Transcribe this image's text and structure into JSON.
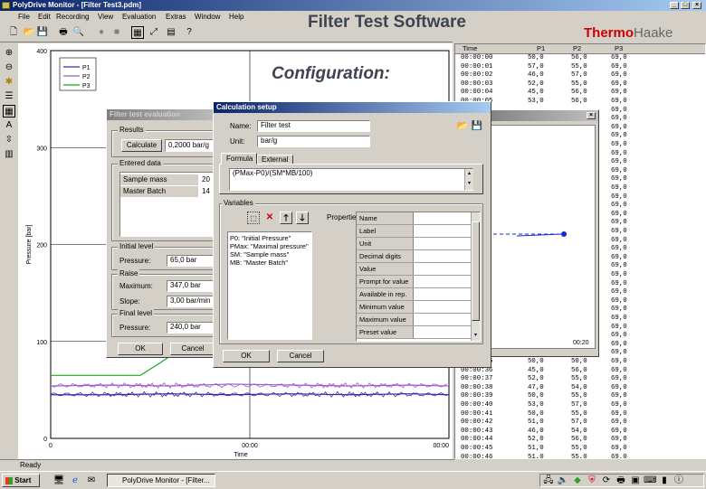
{
  "app": {
    "title": "PolyDrive Monitor - [Filter Test3.pdm]",
    "menu": [
      "File",
      "Edit",
      "Recording",
      "View",
      "Evaluation",
      "Extras",
      "Window",
      "Help"
    ],
    "status": "Ready"
  },
  "overlay": {
    "heading": "Filter Test Software",
    "logo_bold": "Thermo",
    "logo_light": "Haake",
    "subheading": "Configuration:"
  },
  "chart_data": {
    "type": "line",
    "ylabel": "Pressure [bar]",
    "xlabel": "Time",
    "y_ticks": [
      "400",
      "300",
      "200",
      "100",
      "0"
    ],
    "x_ticks": [
      "0",
      "00:00",
      "00:00"
    ],
    "ylim": [
      0,
      400
    ],
    "xlim": [
      0,
      2
    ],
    "legend": [
      "P1",
      "P2",
      "P3"
    ],
    "legend_placement": "top-left",
    "series": [
      {
        "name": "P1",
        "color": "#3b2aa8",
        "x": [
          0,
          0.3,
          0.6,
          0.9,
          1.2,
          1.5,
          1.8,
          2.0
        ],
        "y": [
          45,
          45,
          46,
          45,
          46,
          45,
          46,
          45
        ]
      },
      {
        "name": "P2",
        "color": "#9b59d0",
        "x": [
          0,
          0.3,
          0.6,
          0.9,
          1.2,
          1.5,
          1.8,
          2.0
        ],
        "y": [
          54,
          55,
          54,
          56,
          55,
          54,
          55,
          54
        ]
      },
      {
        "name": "P3",
        "color": "#1fa91f",
        "x": [
          0,
          0.35,
          0.45,
          0.55,
          0.6
        ],
        "y": [
          65,
          65,
          65,
          78,
          85
        ]
      }
    ]
  },
  "table": {
    "headers": [
      "Time",
      "P1",
      "P2",
      "P3"
    ],
    "rows": [
      [
        "00:00:00",
        "50,0",
        "56,0",
        "69,0"
      ],
      [
        "00:00:01",
        "57,0",
        "55,0",
        "69,0"
      ],
      [
        "00:00:02",
        "46,0",
        "57,0",
        "69,0"
      ],
      [
        "00:00:03",
        "52,0",
        "55,0",
        "69,0"
      ],
      [
        "00:00:04",
        "45,0",
        "56,0",
        "69,0"
      ],
      [
        "00:00:05",
        "53,0",
        "56,0",
        "69,0"
      ],
      [
        "",
        "",
        "",
        "69,0"
      ],
      [
        "",
        "",
        "",
        "69,0"
      ],
      [
        "",
        "",
        "",
        "69,0"
      ],
      [
        "",
        "",
        "",
        "69,0"
      ],
      [
        "",
        "",
        "",
        "69,0"
      ],
      [
        "",
        "",
        "",
        "69,0"
      ],
      [
        "",
        "",
        "",
        "69,0"
      ],
      [
        "",
        "",
        "",
        "69,0"
      ],
      [
        "",
        "",
        "",
        "69,0"
      ],
      [
        "",
        "",
        "",
        "69,0"
      ],
      [
        "",
        "",
        "",
        "69,0"
      ],
      [
        "",
        "",
        "",
        "69,0"
      ],
      [
        "",
        "",
        "",
        "69,0"
      ],
      [
        "",
        "",
        "",
        "69,0"
      ],
      [
        "",
        "",
        "",
        "69,0"
      ],
      [
        "",
        "",
        "",
        "69,0"
      ],
      [
        "",
        "",
        "",
        "69,0"
      ],
      [
        "",
        "",
        "",
        "69,0"
      ],
      [
        "",
        "",
        "",
        "69,0"
      ],
      [
        "",
        "",
        "",
        "69,0"
      ],
      [
        "",
        "",
        "",
        "69,0"
      ],
      [
        "",
        "",
        "",
        "69,0"
      ],
      [
        "",
        "",
        "",
        "69,0"
      ],
      [
        "",
        "",
        "",
        "69,0"
      ],
      [
        "",
        "",
        "",
        "69,0"
      ],
      [
        "",
        "",
        "",
        "69,0"
      ],
      [
        "",
        "",
        "",
        "69,0"
      ],
      [
        "",
        "",
        "",
        "69,0"
      ],
      [
        "",
        "",
        "",
        "69,0"
      ],
      [
        "00:00:35",
        "50,0",
        "50,0",
        "69,0"
      ],
      [
        "00:00:36",
        "45,0",
        "56,0",
        "69,0"
      ],
      [
        "00:00:37",
        "52,0",
        "55,0",
        "69,0"
      ],
      [
        "00:00:38",
        "47,0",
        "54,0",
        "69,0"
      ],
      [
        "00:00:39",
        "50,0",
        "55,0",
        "69,0"
      ],
      [
        "00:00:40",
        "53,0",
        "57,0",
        "69,0"
      ],
      [
        "00:00:41",
        "50,0",
        "55,0",
        "69,0"
      ],
      [
        "00:00:42",
        "51,0",
        "57,0",
        "69,0"
      ],
      [
        "00:00:43",
        "46,0",
        "54,0",
        "69,0"
      ],
      [
        "00:00:44",
        "52,0",
        "56,0",
        "69,0"
      ],
      [
        "00:00:45",
        "51,0",
        "55,0",
        "69,0"
      ],
      [
        "00:00:46",
        "51,0",
        "55,0",
        "69,0"
      ]
    ]
  },
  "filter_eval": {
    "title": "Filter test evaluation",
    "results_title": "Results",
    "calculate": "Calculate",
    "result_value": "0,2000 bar/g",
    "entered_title": "Entered data",
    "entered_rows": [
      [
        "Sample mass",
        "20"
      ],
      [
        "Master Batch",
        "14"
      ]
    ],
    "initial_title": "Initial level",
    "pressure_label": "Pressure:",
    "initial_pressure": "65,0 bar",
    "raise_title": "Raise",
    "maximum_label": "Maximum:",
    "maximum": "347,0 bar",
    "slope_label": "Slope:",
    "slope": "3,00 bar/min",
    "final_title": "Final level",
    "final_pressure_label": "Pressure:",
    "final_pressure": "240,0 bar",
    "ok": "OK",
    "cancel": "Cancel"
  },
  "calc_setup": {
    "title": "Calculation setup",
    "name_label": "Name:",
    "name_value": "Filter test",
    "unit_label": "Unit:",
    "unit_value": "bar/g",
    "tabs": [
      "Formula",
      "External"
    ],
    "formula": "(PMax-P0)/(SM*MB/100)",
    "variables_title": "Variables",
    "properties_label": "Properties:",
    "variables": [
      "P0: \"Initial Pressure\"",
      "PMax: \"Maximal pressure\"",
      "SM: \"Sample mass\"",
      "MB: \"Master Batch\""
    ],
    "properties": [
      "Name",
      "Label",
      "Unit",
      "Decimal digits",
      "Value",
      "Prompt for value",
      "Available in rep.",
      "Minimum value",
      "Maximum value",
      "Preset value"
    ],
    "ok": "OK",
    "cancel": "Cancel"
  },
  "bg_window": {
    "x_end": "00:20"
  },
  "taskbar": {
    "start": "Start",
    "task": "PolyDrive Monitor - [Filter..."
  },
  "colors": {
    "title_active": "#0a246a",
    "p1": "#3b2aa8",
    "p2": "#9b59d0",
    "p3": "#1fa91f",
    "logo_red": "#cc0000"
  }
}
